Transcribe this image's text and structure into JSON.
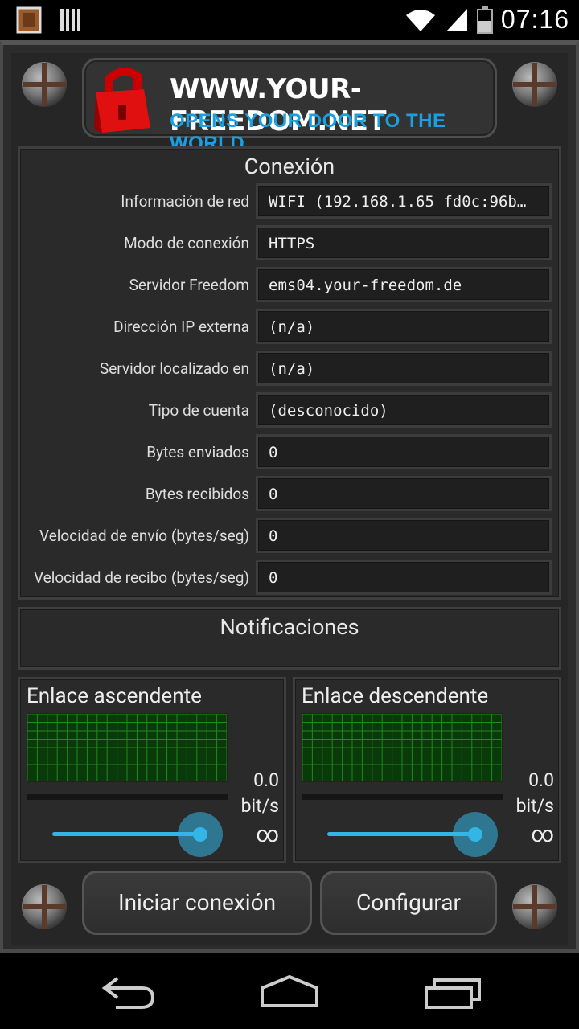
{
  "status_bar": {
    "time": "07:16",
    "icons": [
      "app-icon",
      "sim-icon",
      "wifi-icon",
      "signal-icon",
      "battery-icon"
    ]
  },
  "banner": {
    "title": "WWW.YOUR-FREEDOM.NET",
    "subtitle": "OPENS YOUR DOOR TO THE WORLD",
    "accent_color": "#1aa0e0"
  },
  "connection": {
    "title": "Conexión",
    "rows": [
      {
        "label": "Información de red",
        "value": "WIFI (192.168.1.65 fd0c:96b…"
      },
      {
        "label": "Modo de conexión",
        "value": "HTTPS"
      },
      {
        "label": "Servidor Freedom",
        "value": "ems04.your-freedom.de"
      },
      {
        "label": "Dirección IP externa",
        "value": "(n/a)"
      },
      {
        "label": "Servidor localizado en",
        "value": "(n/a)"
      },
      {
        "label": "Tipo de cuenta",
        "value": "(desconocido)"
      },
      {
        "label": "Bytes enviados",
        "value": "0"
      },
      {
        "label": "Bytes recibidos",
        "value": "0"
      },
      {
        "label": "Velocidad de envío (bytes/seg)",
        "value": "0"
      },
      {
        "label": "Velocidad de recibo (bytes/seg)",
        "value": "0"
      }
    ]
  },
  "notifications": {
    "title": "Notificaciones"
  },
  "uplink": {
    "title": "Enlace ascendente",
    "speed": "0.0",
    "unit": "bit/s",
    "limit": "∞",
    "slider_level": 1.0
  },
  "downlink": {
    "title": "Enlace descendente",
    "speed": "0.0",
    "unit": "bit/s",
    "limit": "∞",
    "slider_level": 1.0
  },
  "buttons": {
    "start": "Iniciar conexión",
    "configure": "Configurar"
  },
  "nav": {
    "icons": [
      "back-icon",
      "home-icon",
      "recents-icon"
    ]
  }
}
